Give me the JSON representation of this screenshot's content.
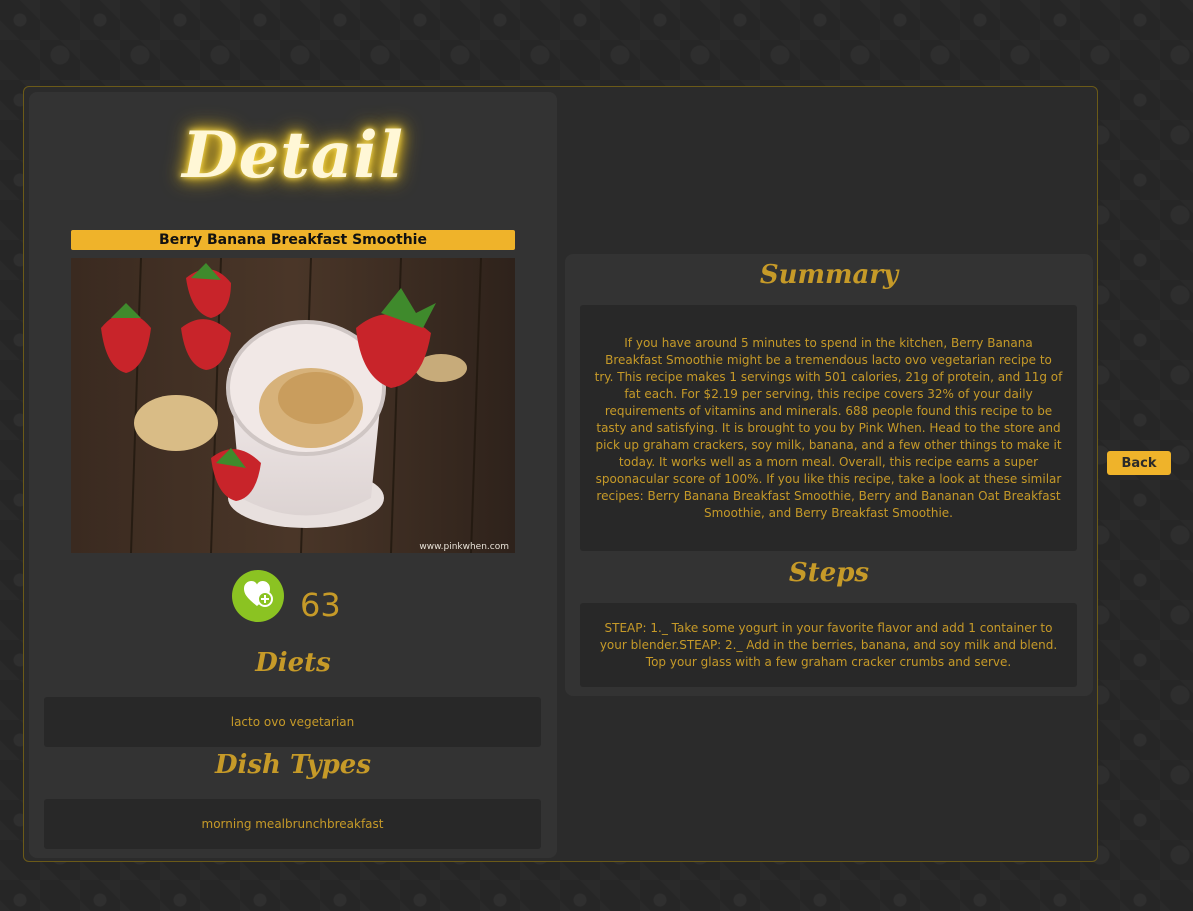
{
  "page": {
    "title": "Detail"
  },
  "recipe": {
    "title": "Berry Banana Breakfast Smoothie",
    "image_alt": "Berry Banana Breakfast Smoothie",
    "image_watermark": "www.pinkwhen.com",
    "likes": "63"
  },
  "sections": {
    "diets_heading": "Diets",
    "diets_value": "lacto ovo vegetarian",
    "dish_types_heading": "Dish Types",
    "dish_types_value": "morning mealbrunchbreakfast",
    "summary_heading": "Summary",
    "summary_text": "If you have around 5 minutes to spend in the kitchen, Berry Banana Breakfast Smoothie might be a tremendous lacto ovo vegetarian recipe to try. This recipe makes 1 servings with 501 calories, 21g of protein, and 11g of fat each. For $2.19 per serving, this recipe covers 32% of your daily requirements of vitamins and minerals. 688 people found this recipe to be tasty and satisfying. It is brought to you by Pink When. Head to the store and pick up graham crackers, soy milk, banana, and a few other things to make it today. It works well as a morn meal. Overall, this recipe earns a super spoonacular score of 100%. If you like this recipe, take a look at these similar recipes: Berry Banana Breakfast Smoothie, Berry and Bananan Oat Breakfast Smoothie, and Berry Breakfast Smoothie.",
    "steps_heading": "Steps",
    "steps_text": "STEAP: 1._ Take some yogurt in your favorite flavor and add 1 container to your blender.STEAP: 2._ Add in the berries, banana, and soy milk and blend. Top your glass with a few graham cracker crumbs and serve."
  },
  "actions": {
    "back_label": "Back"
  },
  "icons": {
    "like": "heart-plus-icon"
  },
  "colors": {
    "accent": "#efb32a",
    "text_gold": "#c69a28",
    "like_green": "#8bc322",
    "panel": "#333333",
    "box": "#282828"
  }
}
